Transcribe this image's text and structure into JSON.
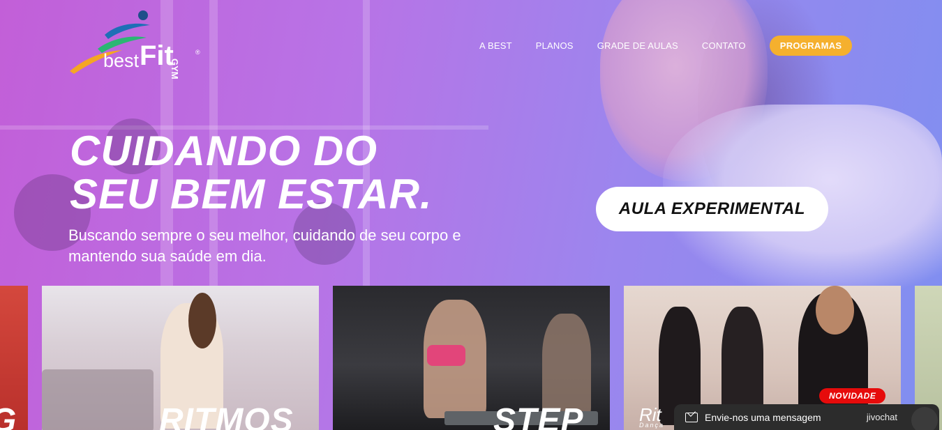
{
  "brand": {
    "logo_word": "best",
    "logo_fit": "Fit",
    "logo_gym": "GYM",
    "logo_reg": "®",
    "logo_colors": [
      "#1e6fb6",
      "#2bb673",
      "#f5a623"
    ]
  },
  "nav": {
    "items": [
      "A BEST",
      "PLANOS",
      "GRADE DE AULAS",
      "CONTATO"
    ],
    "cta": "PROGRAMAS",
    "cta_color": "#f5b02e"
  },
  "hero": {
    "headline_line1": "CUIDANDO DO",
    "headline_line2": "SEU BEM ESTAR.",
    "subtext": "Buscando sempre o seu melhor, cuidando de seu corpo e mantendo sua saúde em dia.",
    "cta": "AULA EXPERIMENTAL"
  },
  "cards": [
    {
      "label": "G"
    },
    {
      "label": "RITMOS"
    },
    {
      "label": "STEP"
    },
    {
      "label": "Rit",
      "sublabel": "Dança",
      "badge": "NOVIDADE"
    }
  ],
  "chat": {
    "message": "Envie-nos uma mensagem",
    "brand": "jivochat",
    "icon": "envelope-icon"
  }
}
